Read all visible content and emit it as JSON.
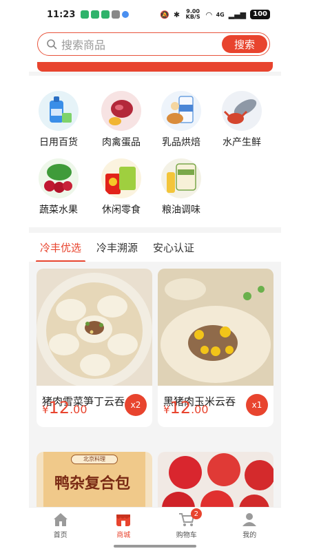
{
  "status_bar": {
    "time": "11:23",
    "network_speed": "9.00 KB/S",
    "signal": "4G",
    "battery": "100"
  },
  "search": {
    "placeholder": "搜索商品",
    "button_label": "搜索"
  },
  "categories": [
    {
      "label": "日用百货",
      "icon": "detergent-icon"
    },
    {
      "label": "肉禽蛋品",
      "icon": "meat-egg-icon"
    },
    {
      "label": "乳品烘焙",
      "icon": "milk-bread-icon"
    },
    {
      "label": "水产生鲜",
      "icon": "fish-crab-icon"
    },
    {
      "label": "蔬菜水果",
      "icon": "vegetable-fruit-icon"
    },
    {
      "label": "休闲零食",
      "icon": "snack-icon"
    },
    {
      "label": "粮油调味",
      "icon": "rice-oil-icon"
    }
  ],
  "tabs": [
    {
      "label": "冷丰优选",
      "active": true
    },
    {
      "label": "冷丰溯源",
      "active": false
    },
    {
      "label": "安心认证",
      "active": false
    }
  ],
  "products": [
    {
      "title": "猪肉雪菜笋丁云吞",
      "price_yen": "¥",
      "price_int": "12",
      "price_dec": ".00",
      "qty": "x2"
    },
    {
      "title": "黑猪肉玉米云吞",
      "price_yen": "¥",
      "price_int": "12",
      "price_dec": ".00",
      "qty": "x1"
    },
    {
      "title": "",
      "package_text": "鸭杂复合包",
      "brand_text": "北京料理"
    },
    {
      "title": ""
    }
  ],
  "bottom_nav": [
    {
      "label": "首页",
      "icon": "home-icon",
      "active": false
    },
    {
      "label": "商城",
      "icon": "shop-icon",
      "active": true
    },
    {
      "label": "购物车",
      "icon": "cart-icon",
      "active": false,
      "badge": "2"
    },
    {
      "label": "我的",
      "icon": "profile-icon",
      "active": false
    }
  ],
  "colors": {
    "accent": "#e8442e"
  }
}
